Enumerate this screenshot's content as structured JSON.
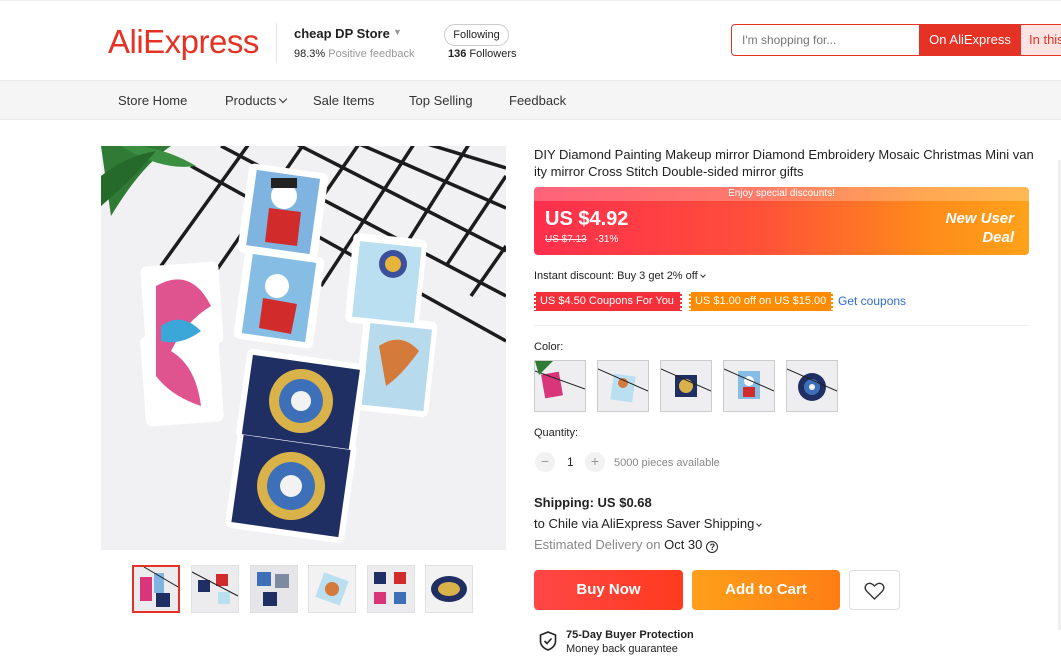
{
  "header": {
    "logo": "AliExpress",
    "store_name": "cheap DP Store",
    "feedback_pct": "98.3%",
    "feedback_label": "Positive feedback",
    "follow_label": "Following",
    "followers_count": "136",
    "followers_label": "Followers",
    "search_placeholder": "I'm shopping for...",
    "search_on_ali": "On AliExpress",
    "search_in_this": "In this store"
  },
  "nav": {
    "items": [
      "Store Home",
      "Products",
      "Sale Items",
      "Top Selling",
      "Feedback"
    ]
  },
  "product": {
    "title": "DIY Diamond Painting Makeup mirror Diamond Embroidery Mosaic Christmas Mini vanity mirror Cross Stitch Double-sided mirror gifts",
    "banner_text": "Enjoy special discounts!",
    "price": "US $4.92",
    "old_price": "US $7.13",
    "discount": "-31%",
    "deal_line1": "New User",
    "deal_line2": "Deal",
    "instant_discount": "Instant discount: Buy 3 get 2% off",
    "coupon1": "US $4.50 Coupons For You",
    "coupon2": "US $1.00 off on US $15.00",
    "get_coupons": "Get coupons",
    "color_label": "Color:",
    "quantity_label": "Quantity:",
    "quantity": "1",
    "qty_minus": "−",
    "qty_plus": "+",
    "available": "5000 pieces available",
    "shipping": "Shipping: US $0.68",
    "ship_to": "to Chile via AliExpress Saver Shipping",
    "est_label": "Estimated Delivery on",
    "est_date": "Oct 30",
    "est_help": "?",
    "buy_now": "Buy Now",
    "add_to_cart": "Add to Cart",
    "protection_title": "75-Day Buyer Protection",
    "protection_sub": "Money back guarantee"
  },
  "icons": {
    "wishlist": "heart-icon",
    "protection": "shield-check-icon",
    "help": "question-circle-icon"
  },
  "colors": {
    "brand_red": "#e43225",
    "price_gradient_start": "#ff2e4d",
    "price_gradient_end": "#ffa21a",
    "coupon_red": "#f5303b",
    "coupon_orange": "#ff8c00",
    "link_blue": "#2e6dd1"
  }
}
